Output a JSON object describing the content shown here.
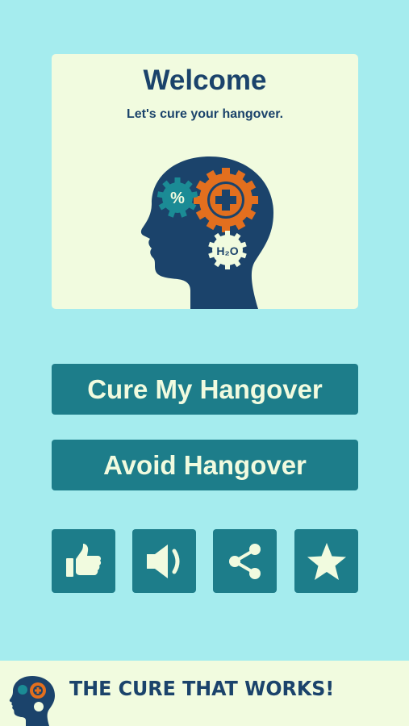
{
  "welcome_card": {
    "title": "Welcome",
    "subtitle": "Let's cure your hangover.",
    "gear_percent": "%",
    "gear_h2o": "H₂O"
  },
  "buttons": {
    "cure_label": "Cure My Hangover",
    "avoid_label": "Avoid Hangover"
  },
  "icon_buttons": [
    {
      "name": "thumbs-up-icon",
      "purpose": "like"
    },
    {
      "name": "speaker-icon",
      "purpose": "sound"
    },
    {
      "name": "share-icon",
      "purpose": "share"
    },
    {
      "name": "star-icon",
      "purpose": "rate"
    }
  ],
  "footer": {
    "tagline": "THE CURE THAT WORKS!"
  },
  "colors": {
    "background": "#a5ecee",
    "card": "#f1fbdf",
    "button": "#1d7d8a",
    "navy": "#1b436b",
    "orange": "#e36f1e",
    "teal": "#1b8b95"
  }
}
